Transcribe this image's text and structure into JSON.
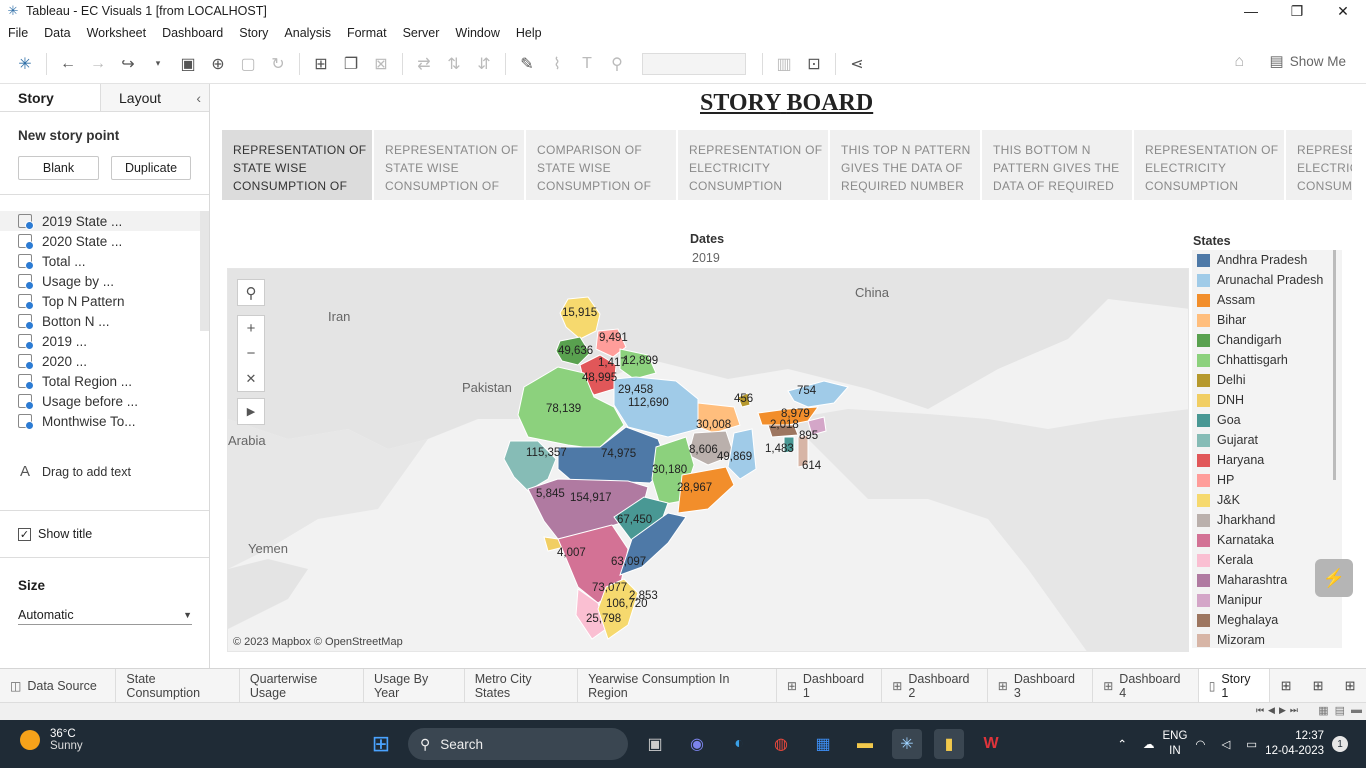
{
  "window": {
    "title": "Tableau - EC Visuals 1 [from LOCALHOST]",
    "controls": [
      "—",
      "❐",
      "✕"
    ]
  },
  "menu": [
    "File",
    "Data",
    "Worksheet",
    "Dashboard",
    "Story",
    "Analysis",
    "Format",
    "Server",
    "Window",
    "Help"
  ],
  "toolbar": {
    "show_me": "Show Me"
  },
  "left_panel": {
    "tabs": {
      "story": "Story",
      "layout": "Layout"
    },
    "new_story_point": "New story point",
    "blank_button": "Blank",
    "duplicate_button": "Duplicate",
    "sheets": [
      "2019 State ...",
      "2020 State ...",
      "Total ...",
      "Usage by ...",
      "Top N Pattern",
      "Botton N ...",
      "2019 ...",
      "2020 ...",
      "Total Region ...",
      "Usage before ...",
      "Monthwise To..."
    ],
    "drag_text": "Drag to add text",
    "show_title": "Show title",
    "size_heading": "Size",
    "size_value": "Automatic"
  },
  "story": {
    "title_part1": "STORY",
    "title_part2": "BOARD",
    "points": [
      "REPRESENTATION OF STATE WISE CONSUMPTION OF",
      "REPRESENTATION OF STATE WISE CONSUMPTION OF",
      "COMPARISON OF STATE WISE CONSUMPTION OF",
      "REPRESENTATION OF ELECTRICITY CONSUMPTION",
      "THIS TOP N PATTERN GIVES THE DATA OF REQUIRED NUMBER",
      "THIS BOTTOM N PATTERN GIVES THE DATA OF REQUIRED",
      "REPRESENTATION OF ELECTRICITY CONSUMPTION",
      "REPRESENTATION OF ELECTRICITY CONSUMPTION"
    ],
    "active_point": 0
  },
  "filter": {
    "label": "Dates",
    "value": "2019"
  },
  "map": {
    "countries": {
      "iran": "Iran",
      "pakistan": "Pakistan",
      "china": "China",
      "arabia": "Arabia",
      "yemen": "Yemen"
    },
    "attribution": "© 2023 Mapbox © OpenStreetMap",
    "values": {
      "jk": "15,915",
      "hp": "9,491",
      "punjab": "49,636",
      "haryana": "48,995",
      "chandigarh": "1,417",
      "uttarakhand": "12,899",
      "delhi": "29,458",
      "up": "112,690",
      "rajasthan": "78,139",
      "bihar": "30,008",
      "sikkim": "456",
      "assam": "8,979",
      "arunachal": "754",
      "meghalaya": "2,018",
      "nagaland": "895",
      "tripura": "1,483",
      "mizoram": "614",
      "gujarat": "115,357",
      "mp": "74,975",
      "jharkhand": "8,606",
      "wb": "49,869",
      "chhattisgarh": "30,180",
      "odisha": "28,967",
      "dnh": "5,845",
      "maharashtra": "154,917",
      "telangana": "67,450",
      "goa": "4,007",
      "ap": "63,097",
      "karnataka": "73,077",
      "tn": "106,720",
      "puducherry": "2,853",
      "kerala": "25,798"
    }
  },
  "legend": {
    "title": "States",
    "items": [
      {
        "name": "Andhra Pradesh",
        "color": "#4e79a7"
      },
      {
        "name": "Arunachal Pradesh",
        "color": "#a0cbe8"
      },
      {
        "name": "Assam",
        "color": "#f28e2b"
      },
      {
        "name": "Bihar",
        "color": "#ffbe7d"
      },
      {
        "name": "Chandigarh",
        "color": "#59a14f"
      },
      {
        "name": "Chhattisgarh",
        "color": "#8cd17d"
      },
      {
        "name": "Delhi",
        "color": "#b6992d"
      },
      {
        "name": "DNH",
        "color": "#f1ce63"
      },
      {
        "name": "Goa",
        "color": "#499894"
      },
      {
        "name": "Gujarat",
        "color": "#86bcb6"
      },
      {
        "name": "Haryana",
        "color": "#e15759"
      },
      {
        "name": "HP",
        "color": "#ff9d9a"
      },
      {
        "name": "J&K",
        "color": "#f6d96e"
      },
      {
        "name": "Jharkhand",
        "color": "#bab0ac"
      },
      {
        "name": "Karnataka",
        "color": "#d37295"
      },
      {
        "name": "Kerala",
        "color": "#fabfd2"
      },
      {
        "name": "Maharashtra",
        "color": "#b07aa1"
      },
      {
        "name": "Manipur",
        "color": "#d4a6c8"
      },
      {
        "name": "Meghalaya",
        "color": "#9d7660"
      },
      {
        "name": "Mizoram",
        "color": "#d7b5a6"
      }
    ]
  },
  "sheet_tabs": [
    "Data Source",
    "State Consumption",
    "Quarterwise Usage",
    "Usage By Year",
    "Metro City States",
    "Yearwise Consumption In Region",
    "Dashboard 1",
    "Dashboard 2",
    "Dashboard 3",
    "Dashboard 4",
    "Story 1"
  ],
  "taskbar": {
    "temperature": "36°C",
    "weather": "Sunny",
    "search": "Search",
    "lang1": "ENG",
    "lang2": "IN",
    "time": "12:37",
    "date": "12-04-2023",
    "notifications": "1"
  }
}
